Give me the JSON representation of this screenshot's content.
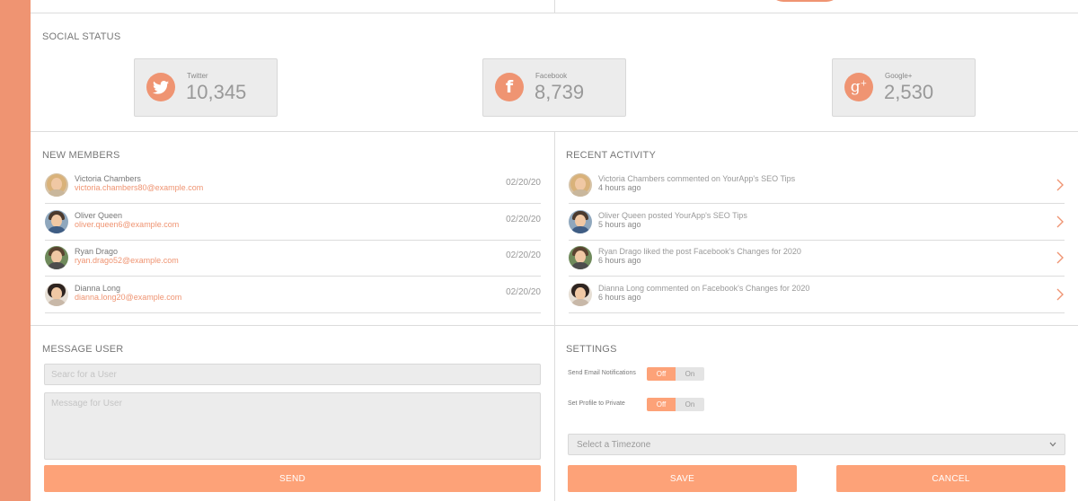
{
  "social": {
    "title": "SOCIAL STATUS",
    "cards": [
      {
        "name": "Twitter",
        "count": "10,345",
        "icon": "twitter-icon"
      },
      {
        "name": "Facebook",
        "count": "8,739",
        "icon": "facebook-icon"
      },
      {
        "name": "Google+",
        "count": "2,530",
        "icon": "google-plus-icon"
      }
    ]
  },
  "new_members": {
    "title": "NEW MEMBERS",
    "rows": [
      {
        "name": "Victoria Chambers",
        "email": "victoria.chambers80@example.com",
        "date": "02/20/20"
      },
      {
        "name": "Oliver Queen",
        "email": "oliver.queen6@example.com",
        "date": "02/20/20"
      },
      {
        "name": "Ryan Drago",
        "email": "ryan.drago52@example.com",
        "date": "02/20/20"
      },
      {
        "name": "Dianna Long",
        "email": "dianna.long20@example.com",
        "date": "02/20/20"
      }
    ]
  },
  "recent_activity": {
    "title": "RECENT ACTIVITY",
    "rows": [
      {
        "text": "Victoria Chambers commented on YourApp's SEO Tips",
        "time": "4 hours ago"
      },
      {
        "text": "Oliver Queen posted YourApp's SEO Tips",
        "time": "5 hours ago"
      },
      {
        "text": "Ryan Drago liked the post Facebook's Changes for 2020",
        "time": "6 hours ago"
      },
      {
        "text": "Dianna Long commented on Facebook's Changes for 2020",
        "time": "6 hours ago"
      }
    ]
  },
  "message_user": {
    "title": "MESSAGE USER",
    "search_placeholder": "Searc for a User",
    "message_placeholder": "Message for User",
    "send_label": "SEND"
  },
  "settings": {
    "title": "SETTINGS",
    "email_label": "Send Email Notifications",
    "private_label": "Set Profile to Private",
    "toggle_off": "Off",
    "toggle_on": "On",
    "timezone_placeholder": "Select a Timezone",
    "save_label": "SAVE",
    "cancel_label": "CANCEL"
  },
  "colors": {
    "accent": "#ef9472",
    "button": "#fda278"
  }
}
